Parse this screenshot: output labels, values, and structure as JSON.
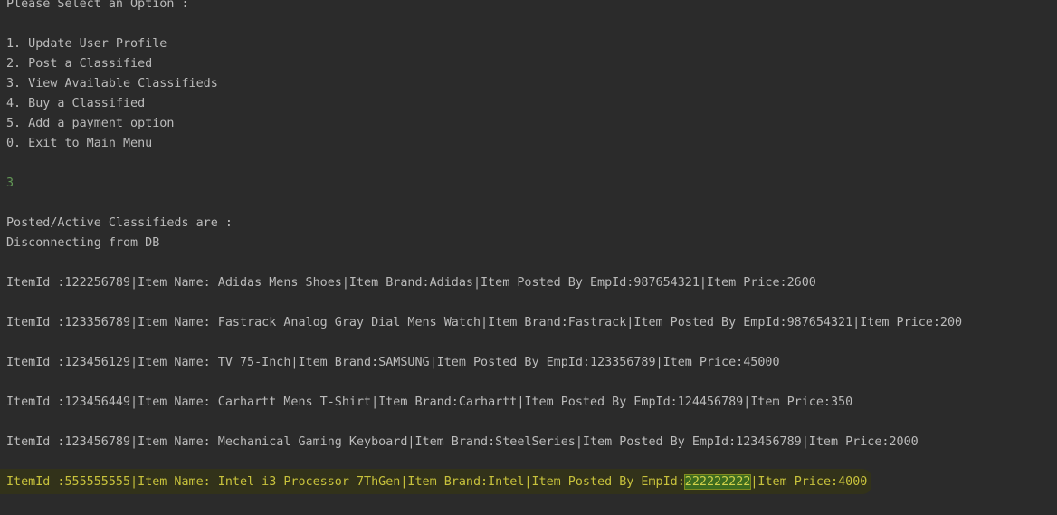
{
  "menu": {
    "prompt": "Please Select an Option :",
    "options": [
      "1. Update User Profile",
      "2. Post a Classified",
      "3. View Available Classifieds",
      "4. Buy a Classified",
      "5. Add a payment option",
      "0. Exit to Main Menu"
    ]
  },
  "user_input": "3",
  "status": {
    "header": "Posted/Active Classifieds are :",
    "db_message": "Disconnecting from DB"
  },
  "classifieds": [
    "ItemId :122256789|Item Name: Adidas Mens Shoes|Item Brand:Adidas|Item Posted By EmpId:987654321|Item Price:2600",
    "ItemId :123356789|Item Name: Fastrack Analog Gray Dial Mens Watch|Item Brand:Fastrack|Item Posted By EmpId:987654321|Item Price:200",
    "ItemId :123456129|Item Name: TV 75-Inch|Item Brand:SAMSUNG|Item Posted By EmpId:123356789|Item Price:45000",
    "ItemId :123456449|Item Name: Carhartt Mens T-Shirt|Item Brand:Carhartt|Item Posted By EmpId:124456789|Item Price:350",
    "ItemId :123456789|Item Name: Mechanical Gaming Keyboard|Item Brand:SteelSeries|Item Posted By EmpId:123456789|Item Price:2000"
  ],
  "highlighted": {
    "prefix": "ItemId :555555555|Item Name: Intel i3 Processor 7ThGen|Item Brand:Intel|Item Posted By EmpId:",
    "empid": "222222222",
    "suffix": "|Item Price:4000"
  },
  "colors": {
    "background": "#2b2b2b",
    "text": "#bbbbbb",
    "input_echo": "#629755",
    "highlight_bg": "#32321a",
    "highlight_text": "#c8c23c",
    "selection_bg": "#3d6b1f"
  }
}
